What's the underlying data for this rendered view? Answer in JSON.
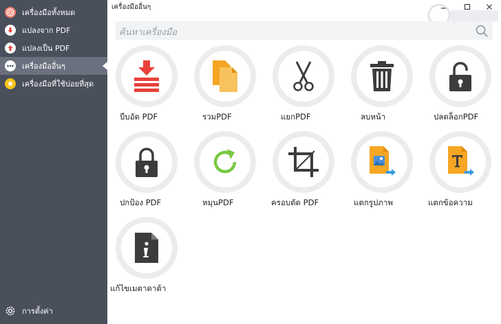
{
  "window": {
    "title": "เครื่องมืออื่นๆ"
  },
  "sidebar": {
    "items": [
      {
        "label": "เครื่องมือทั้งหมด",
        "icon": "target-icon",
        "color": "#f07b6b"
      },
      {
        "label": "แปลงจาก PDF",
        "icon": "arrow-down-icon",
        "color": "#e8413a"
      },
      {
        "label": "แปลงเป็น PDF",
        "icon": "arrow-up-icon",
        "color": "#e8413a"
      },
      {
        "label": "เครื่องมืออื่นๆ",
        "icon": "more-dots-icon",
        "color": "#ffffff"
      },
      {
        "label": "เครื่องมือที่ใช้บ่อยที่สุด",
        "icon": "star-icon",
        "color": "#f5c518"
      }
    ],
    "active_index": 3,
    "settings_label": "การตั้งค่า"
  },
  "search": {
    "placeholder": "ค้นหาเครื่องมือ"
  },
  "tools": [
    {
      "label": "บีบอัด PDF",
      "icon": "compress-icon"
    },
    {
      "label": "รวมPDF",
      "icon": "merge-icon"
    },
    {
      "label": "แยกPDF",
      "icon": "scissors-icon"
    },
    {
      "label": "ลบหน้า",
      "icon": "trash-icon"
    },
    {
      "label": "ปลดล็อกPDF",
      "icon": "unlock-icon"
    },
    {
      "label": "ปกป้อง PDF",
      "icon": "lock-icon"
    },
    {
      "label": "หมุนPDF",
      "icon": "rotate-icon"
    },
    {
      "label": "ครอบตัด PDF",
      "icon": "crop-icon"
    },
    {
      "label": "แตกรูปภาพ",
      "icon": "extract-image-icon"
    },
    {
      "label": "แตกข้อความ",
      "icon": "extract-text-icon"
    },
    {
      "label": "แก้ไขเมตาดาต้า",
      "icon": "info-icon"
    }
  ],
  "colors": {
    "sidebar": "#4a4f5c",
    "sidebar_active": "#6a707d",
    "accent_red": "#e8413a",
    "accent_orange": "#f5a623",
    "accent_green": "#7ac943",
    "icon_dark": "#3c3c3c"
  }
}
